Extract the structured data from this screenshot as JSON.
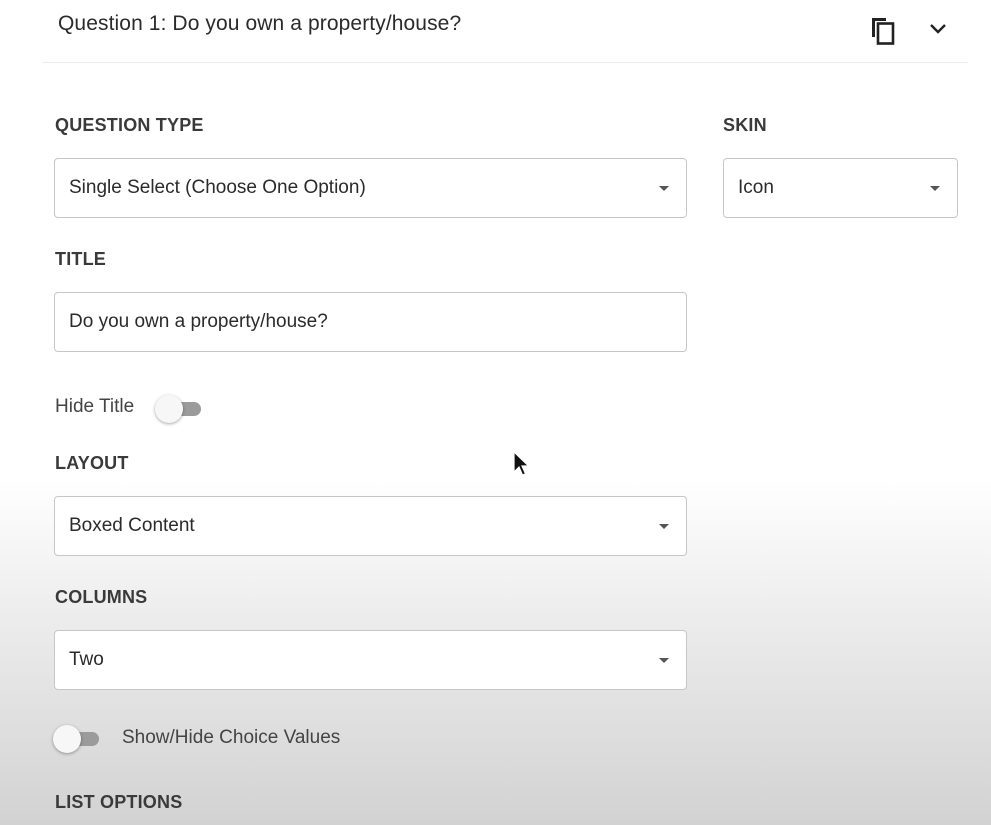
{
  "header": {
    "title": "Question 1: Do you own a property/house?",
    "copy_icon": "copy-icon",
    "collapse_icon": "chevron-down-icon"
  },
  "question_type": {
    "label": "QUESTION TYPE",
    "value": "Single Select (Choose One Option)"
  },
  "skin": {
    "label": "SKIN",
    "value": "Icon"
  },
  "title_field": {
    "label": "TITLE",
    "value": "Do you own a property/house?"
  },
  "hide_title": {
    "label": "Hide Title",
    "on": false
  },
  "layout": {
    "label": "LAYOUT",
    "value": "Boxed Content"
  },
  "columns": {
    "label": "COLUMNS",
    "value": "Two"
  },
  "choice_values": {
    "label": "Show/Hide Choice Values",
    "on": false
  },
  "list_options": {
    "label": "LIST OPTIONS"
  },
  "colors": {
    "toggle_track": "#9b9b9b",
    "field_border": "#c6c6c6"
  }
}
